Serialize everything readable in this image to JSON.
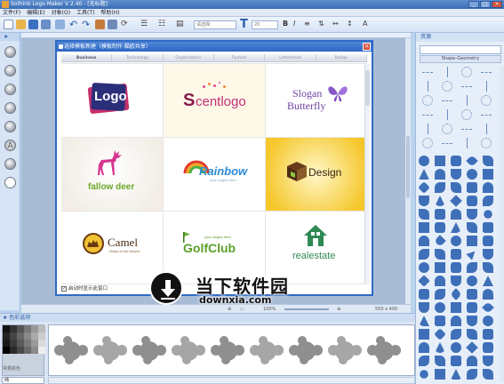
{
  "window": {
    "title": "Sothink Logo Maker V 2.40 - [无标题]"
  },
  "menu": [
    "文件(F)",
    "编辑(E)",
    "对象(O)",
    "工具(T)",
    "帮助(H)"
  ],
  "toolbar": {
    "font_placeholder": "请选择:",
    "size_value": "20"
  },
  "left_panel": {
    "header": "★"
  },
  "dialog": {
    "title": "选择模板新建（模板制作 酷欧共享）",
    "close_label": "×",
    "tabs": [
      "Business",
      "Technology",
      "Organization",
      "Fashion",
      "Letterhead",
      "Badge"
    ],
    "templates": [
      {
        "name": "logo-template-logo",
        "text": "Logo"
      },
      {
        "name": "logo-template-scentlogo",
        "text_s": "S",
        "text_rest": "centlogo"
      },
      {
        "name": "logo-template-slogan-butterfly",
        "text_line1": "Slogan",
        "text_line2": "Butterfly"
      },
      {
        "name": "logo-template-fallow-deer",
        "text": "fallow deer"
      },
      {
        "name": "logo-template-rainbow",
        "text": "Rainbow",
        "subtext": "your slogan here"
      },
      {
        "name": "logo-template-design",
        "text": "Design"
      },
      {
        "name": "logo-template-camel",
        "text": "Camel",
        "subtext": "Ships of the Desert"
      },
      {
        "name": "logo-template-golfclub",
        "text": "GolfClub",
        "subtext": "your slogan here"
      },
      {
        "name": "logo-template-realestate",
        "text": "realestate"
      }
    ],
    "footer_checkbox_label": "启动时显示此窗口"
  },
  "status": {
    "zoom": "100%",
    "dimensions": "550 x 400"
  },
  "right_panel": {
    "header": "资源",
    "category": "Shape-Geometry"
  },
  "bottom_panel": {
    "header": "★ 色彩选项",
    "label": "常量颜色",
    "select_value": "纯"
  },
  "watermark": {
    "title": "当下软件园",
    "url": "downxia.com"
  },
  "colors": {
    "accent": "#2f6ac6",
    "shape_fill": "#3f6fb8",
    "app_bg": "#bcd3ee"
  }
}
